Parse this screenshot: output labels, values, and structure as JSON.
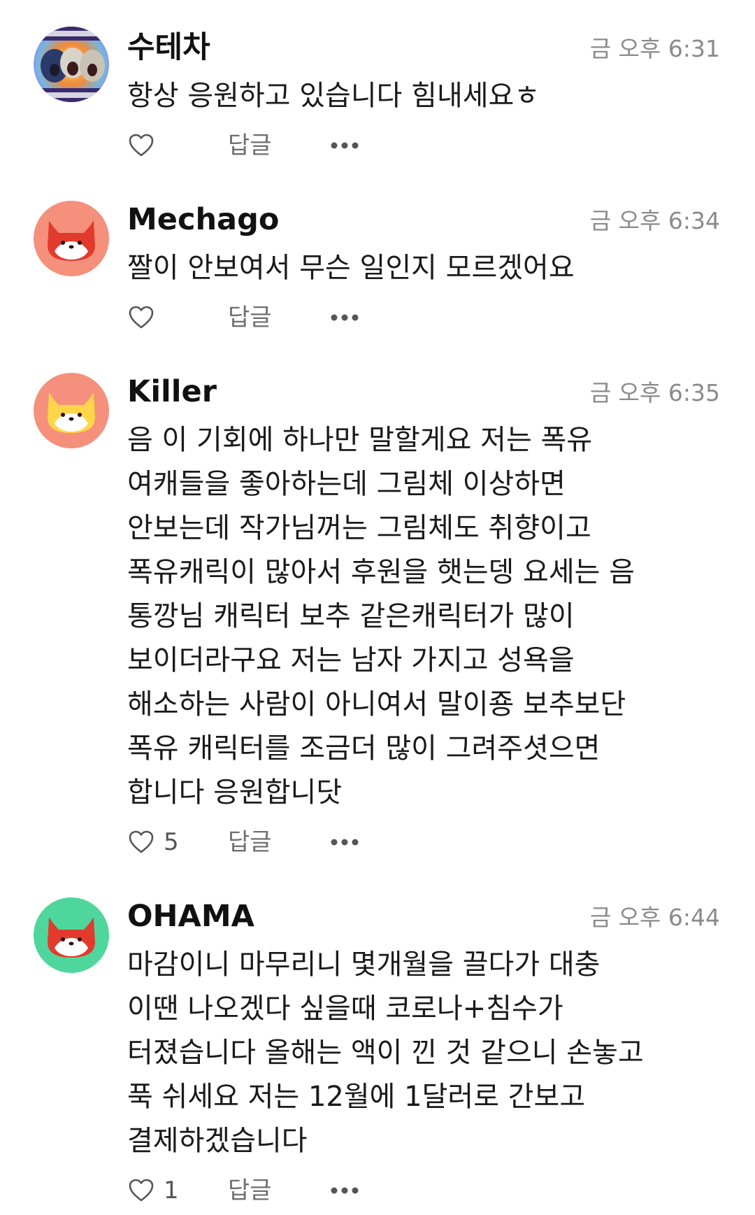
{
  "comments": [
    {
      "username": "수테차",
      "timestamp": "금 오후 6:31",
      "text": "항상 응원하고 있습니다 힘내세요ㅎ",
      "likes": "",
      "reply_label": "답글",
      "avatar": "meme-faces-avatar"
    },
    {
      "username": "Mechago",
      "timestamp": "금 오후 6:34",
      "text": "짤이 안보여서 무슨 일인지 모르겠어요",
      "likes": "",
      "reply_label": "답글",
      "avatar": "red-fox-avatar",
      "avatar_bg": "#f5907c"
    },
    {
      "username": "Killer",
      "timestamp": "금 오후 6:35",
      "text": "음 이 기회에 하나만 말할게요 저는 폭유\n여캐들을 좋아하는데 그림체 이상하면\n안보는데 작가님꺼는 그림체도 취향이고\n폭유캐릭이 많아서 후원을 햇는뎅 요세는 음\n통깡님 캐릭터 보추 같은캐릭터가 많이\n보이더라구요 저는 남자 가지고 성욕을\n해소하는 사람이 아니여서 말이죵 보추보단\n폭유 캐릭터를 조금더 많이 그려주셧으면\n합니다 응원합니닷",
      "likes": "5",
      "reply_label": "답글",
      "avatar": "yellow-fox-avatar",
      "avatar_bg": "#f5907c"
    },
    {
      "username": "OHAMA",
      "timestamp": "금 오후 6:44",
      "text": "마감이니 마무리니 몇개월을 끌다가 대충\n이땐 나오겠다 싶을때 코로나+침수가\n터졌습니다 올해는 액이 낀 것 같으니 손놓고\n푹 쉬세요 저는 12월에 1달러로 간보고\n결제하겠습니다",
      "likes": "1",
      "reply_label": "답글",
      "avatar": "red-fox-avatar",
      "avatar_bg": "#4fd69c"
    }
  ],
  "colors": {
    "fox_red": "#e23b2e",
    "fox_yellow": "#ffd54a",
    "timestamp_gray": "#8a8a8a",
    "icon_gray": "#555555"
  }
}
